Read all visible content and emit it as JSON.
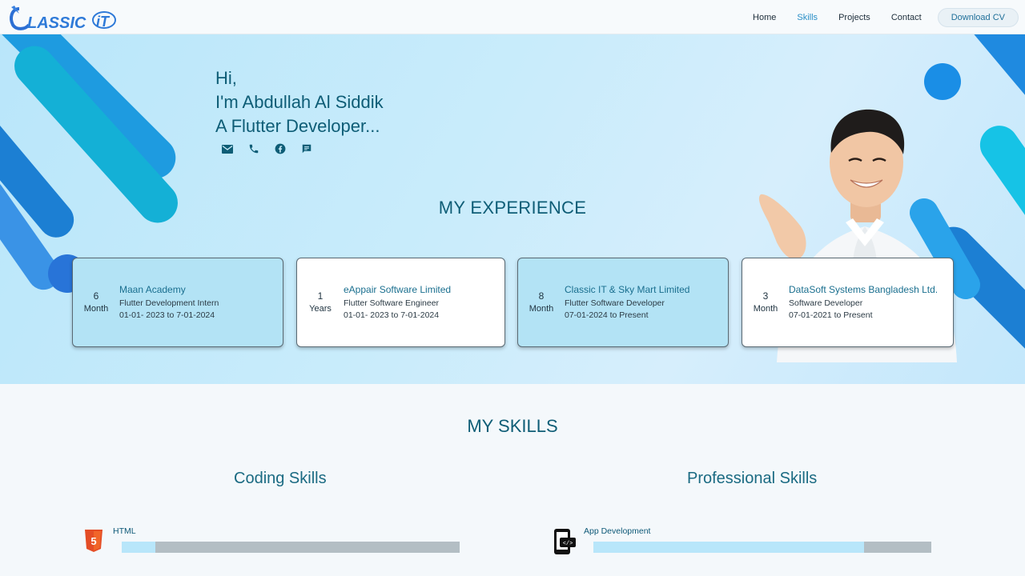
{
  "nav": {
    "brand": "CLASSIC IT",
    "links": [
      "Home",
      "Skills",
      "Projects",
      "Contact"
    ],
    "active": "Skills",
    "cv_button": "Download CV"
  },
  "hero": {
    "line1": "Hi,",
    "line2": "I'm Abdullah Al Siddik",
    "line3": "A Flutter Developer...",
    "socials": [
      "email-icon",
      "phone-icon",
      "facebook-icon",
      "chat-icon"
    ]
  },
  "experience": {
    "title": "MY EXPERIENCE",
    "cards": [
      {
        "num": "6",
        "unit": "Month",
        "company": "Maan Academy",
        "role": "Flutter Development Intern",
        "period": "01-01- 2023 to 7-01-2024"
      },
      {
        "num": "1",
        "unit": "Years",
        "company": "eAppair Software Limited",
        "role": "Flutter Software Engineer",
        "period": "01-01- 2023 to 7-01-2024"
      },
      {
        "num": "8",
        "unit": "Month",
        "company": "Classic IT & Sky Mart Limited",
        "role": "Flutter Software Developer",
        "period": "07-01-2024 to Present"
      },
      {
        "num": "3",
        "unit": "Month",
        "company": "DataSoft Systems Bangladesh Ltd.",
        "role": "Software Developer",
        "period": "07-01-2021 to Present"
      }
    ]
  },
  "skills": {
    "title": "MY SKILLS",
    "coding_title": "Coding Skills",
    "professional_title": "Professional Skills",
    "coding": [
      {
        "name": "HTML",
        "level": 0.1,
        "icon": "html5-icon"
      }
    ],
    "professional": [
      {
        "name": "App Development",
        "level": 0.8,
        "icon": "mobile-code-icon"
      }
    ]
  },
  "colors": {
    "accent": "#0e5d76",
    "card_blue": "#b3e3f5",
    "bar_fill": "#b8e6fa",
    "bar_track": "#b3bec4"
  }
}
